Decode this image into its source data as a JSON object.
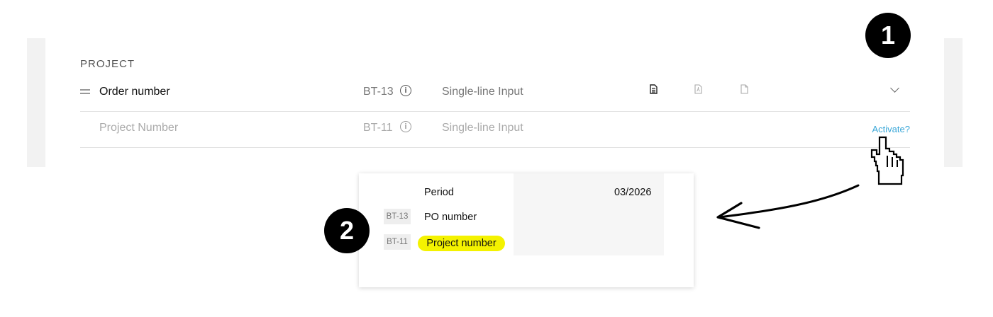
{
  "project": {
    "section_title": "PROJECT",
    "rows": [
      {
        "name": "Order number",
        "code": "BT-13",
        "info_icon": "info-icon",
        "type": "Single-line Input",
        "format_icons": [
          "document-filled-icon",
          "pdf-document-icon",
          "blank-document-icon"
        ],
        "action_icon": "chevron-down-icon"
      },
      {
        "name": "Project Number",
        "code": "BT-11",
        "info_icon": "info-icon",
        "type": "Single-line Input",
        "action_label": "Activate?"
      }
    ]
  },
  "callouts": {
    "step1": "1",
    "step2": "2"
  },
  "preview": {
    "rows": [
      {
        "tag": "",
        "label": "Period",
        "value": "03/2026"
      },
      {
        "tag": "BT-13",
        "label": "PO number"
      },
      {
        "tag": "BT-11",
        "label": "Project number",
        "highlighted": true
      }
    ]
  },
  "colors": {
    "link": "#3aa7d8",
    "highlight": "#f4f200",
    "badge": "#000000"
  },
  "icons": {
    "cursor": "hand-pointer-icon",
    "arrow": "arrow-left-icon"
  }
}
